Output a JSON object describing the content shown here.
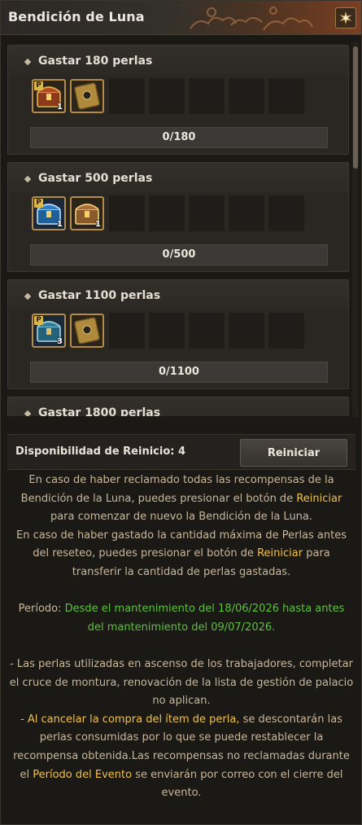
{
  "window": {
    "title": "Bendición de Luna",
    "corner_icon": "moon-emblem-icon"
  },
  "tiers": [
    {
      "label": "Gastar 180 perlas",
      "progress_text": "0/180",
      "progress_fraction": 0,
      "rewards": [
        {
          "icon": "treasure-chest-icon",
          "style": "red-gold",
          "quantity": "1",
          "p_badge": "P"
        },
        {
          "icon": "gold-card-icon",
          "style": "gold",
          "quantity": "",
          "p_badge": ""
        }
      ]
    },
    {
      "label": "Gastar 500 perlas",
      "progress_text": "0/500",
      "progress_fraction": 0,
      "rewards": [
        {
          "icon": "treasure-chest-icon",
          "style": "blue",
          "quantity": "1",
          "p_badge": "P"
        },
        {
          "icon": "treasure-chest-icon",
          "style": "gold",
          "quantity": "1",
          "p_badge": ""
        }
      ]
    },
    {
      "label": "Gastar 1100 perlas",
      "progress_text": "0/1100",
      "progress_fraction": 0,
      "rewards": [
        {
          "icon": "treasure-chest-icon",
          "style": "teal",
          "quantity": "3",
          "p_badge": "P"
        },
        {
          "icon": "gold-card-icon",
          "style": "gold",
          "quantity": "",
          "p_badge": ""
        }
      ]
    },
    {
      "label": "Gastar 1800 perlas",
      "progress_text": "",
      "progress_fraction": 0,
      "rewards": []
    }
  ],
  "reset": {
    "availability": "Disponibilidad de Reinicio: 4",
    "button_label": "Reiniciar"
  },
  "info": {
    "p1_a": "En caso de haber reclamado todas las recompensas de la Bendición de la Luna, puedes presionar el botón de ",
    "p1_hl": "Reiniciar",
    "p1_b": " para comenzar de nuevo la Bendición de la Luna.",
    "p2_a": "En caso de haber gastado la cantidad máxima de Perlas antes del reseteo, puedes presionar el botón de ",
    "p2_hl": "Reiniciar",
    "p2_b": " para transferir la cantidad de perlas gastadas.",
    "period_label": "Período: ",
    "period_value": "Desde el mantenimiento del 18/06/2026 hasta antes del mantenimiento del 09/07/2026.",
    "note1": "- Las perlas utilizadas en ascenso de los trabajadores, completar el cruce de montura, renovación de la lista de gestión de palacio no aplican.",
    "note2_dash": "- ",
    "note2_hl": "Al cancelar la compra del ítem de perla,",
    "note2_a": " se descontarán las perlas consumidas por lo que se puede restablecer la recompensa obtenida.Las recompensas no reclamadas durante el ",
    "note2_hl2": "Período del Evento",
    "note2_b": " se enviarán por correo con el cierre del evento."
  },
  "colors": {
    "highlight": "#f0c24a",
    "period": "#5cc23a",
    "body_text": "#c9b79a"
  }
}
